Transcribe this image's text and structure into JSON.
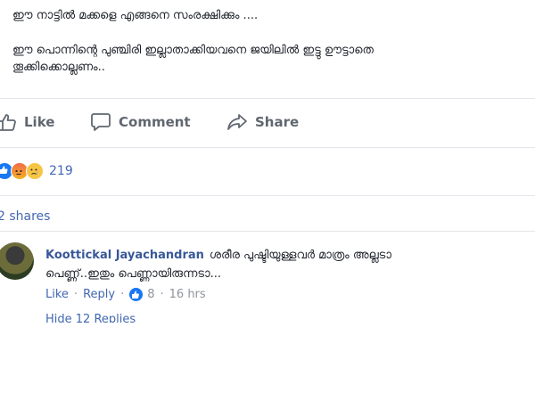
{
  "post": {
    "line1": "ഈ നാട്ടിൽ മക്കളെ എങ്ങനെ സംരക്ഷിക്കും ....",
    "line2": "ഈ പൊന്നിന്റെ പുഞ്ചിരി ഇല്ലാതാക്കിയവനെ ജയിലിൽ ഇട്ടു ഊട്ടാതെ",
    "line3": "തൂക്കിക്കൊല്ലണം.."
  },
  "actions": {
    "like": "Like",
    "comment": "Comment",
    "share": "Share"
  },
  "reactions": {
    "icons": [
      "like-icon",
      "angry-icon",
      "sad-icon"
    ],
    "count": "219"
  },
  "shares": "2 shares",
  "comment": {
    "author": "Koottickal Jayachandran",
    "text1": "ശരീര പുഷ്ടിയുള്ളവർ മാത്രം അല്ലടാ",
    "text2": "പെണ്ണ്..ഇതും പെണ്ണായിരുന്നടാ...",
    "like": "Like",
    "reply": "Reply",
    "likes": "8",
    "time": "16 hrs"
  },
  "hidden_replies": "Hide 12 Replies",
  "colors": {
    "link": "#4267b2",
    "author": "#385898",
    "muted": "#90949c",
    "like_blue": "#1877f2"
  }
}
